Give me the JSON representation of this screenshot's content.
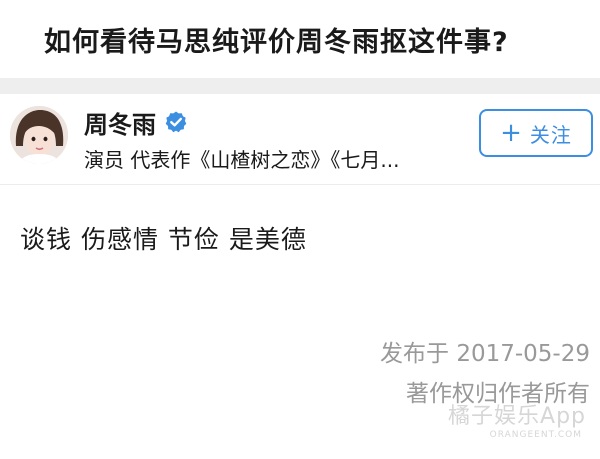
{
  "question": {
    "title": "如何看待马思纯评价周冬雨抠这件事?"
  },
  "author": {
    "name": "周冬雨",
    "verified_icon": "verified-check-icon",
    "description": "演员 代表作《山楂树之恋》《七月...",
    "follow_button": {
      "icon": "+",
      "label": "关注"
    },
    "accent_color": "#3b8ee0"
  },
  "answer": {
    "text": "谈钱 伤感情 节俭 是美德",
    "published": "发布于 2017-05-29",
    "copyright": "著作权归作者所有"
  },
  "watermark": {
    "text": "橘子娱乐App",
    "url": "ORANGEENT.COM"
  }
}
